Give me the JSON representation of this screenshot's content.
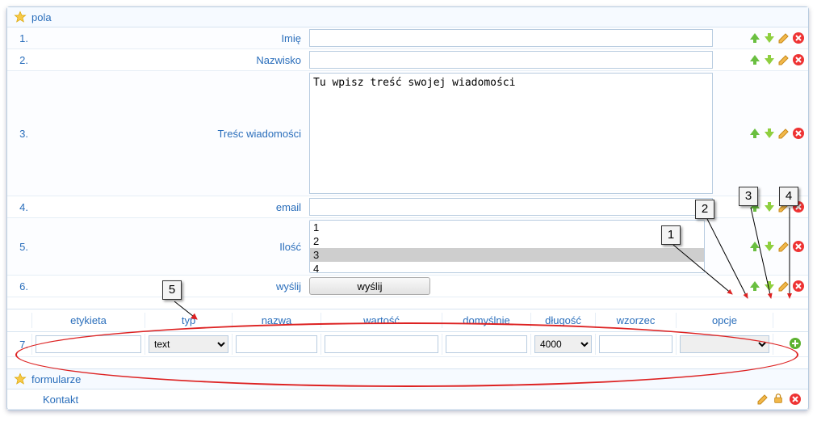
{
  "sections": {
    "fields_title": "pola",
    "forms_title": "formularze"
  },
  "fields": [
    {
      "num": "1.",
      "label": "Imię",
      "type": "text",
      "value": ""
    },
    {
      "num": "2.",
      "label": "Nazwisko",
      "type": "text",
      "value": ""
    },
    {
      "num": "3.",
      "label": "Treśc wiadomości",
      "type": "textarea",
      "value": "Tu wpisz treść swojej wiadomości"
    },
    {
      "num": "4.",
      "label": "email",
      "type": "text",
      "value": ""
    },
    {
      "num": "5.",
      "label": "Ilość",
      "type": "listbox",
      "options": [
        "1",
        "2",
        "3",
        "4"
      ],
      "selected": "3"
    },
    {
      "num": "6.",
      "label": "wyślij",
      "type": "button",
      "button_label": "wyślij"
    }
  ],
  "new_field_row": {
    "num": "7.",
    "columns": {
      "etykieta": "etykieta",
      "typ": "typ",
      "nazwa": "nazwa",
      "wartosc": "wartość",
      "domyslnie": "domyślnie",
      "dlugosc": "długość",
      "wzorzec": "wzorzec",
      "opcje": "opcje"
    },
    "typ_value": "text",
    "dlugosc_value": "4000"
  },
  "forms": [
    {
      "name": "Kontakt"
    }
  ],
  "annotations": {
    "callouts": [
      "1",
      "2",
      "3",
      "4",
      "5"
    ]
  }
}
